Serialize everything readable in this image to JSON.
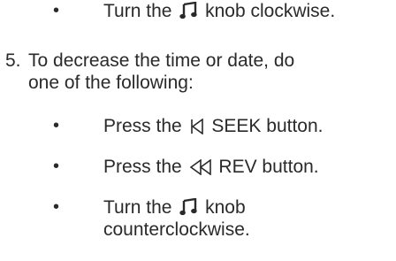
{
  "page": {
    "bullet_glyph": "•",
    "top_item": {
      "text_before": "Turn the",
      "icon": "music-note-icon",
      "text_after": "knob clockwise."
    },
    "step5": {
      "number": "5.",
      "line1": "To decrease the time or date, do",
      "line2": "one of the following:",
      "bullets": [
        {
          "text_before": "Press the",
          "icon": "seek-back-icon",
          "text_after": "SEEK button."
        },
        {
          "text_before": "Press the",
          "icon": "rewind-icon",
          "text_after": "REV button."
        },
        {
          "text_before": "Turn the",
          "icon": "music-note-icon",
          "text_after": "knob",
          "line2": "counterclockwise."
        }
      ]
    }
  }
}
